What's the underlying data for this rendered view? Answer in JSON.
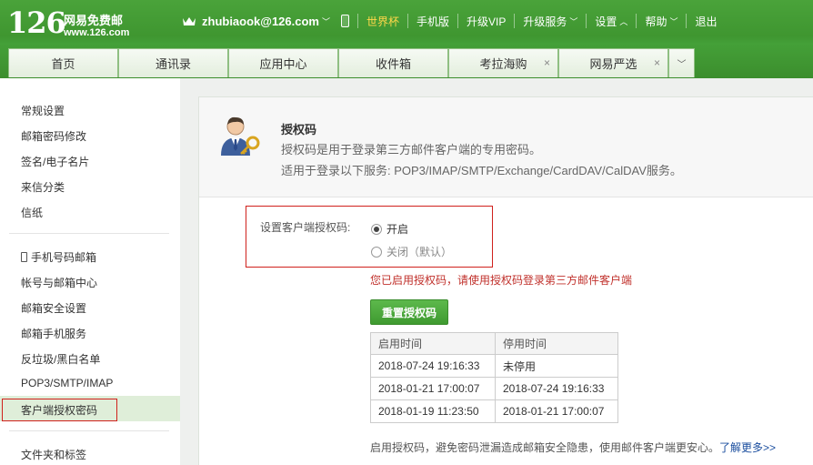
{
  "logo": {
    "number": "126",
    "name": "网易免费邮",
    "url": "www.126.com"
  },
  "topnav": {
    "user": "zhubiaook@126.com",
    "items": [
      "世界杯",
      "手机版",
      "升级VIP",
      "升级服务",
      "设置",
      "帮助",
      "退出"
    ]
  },
  "tabs": [
    "首页",
    "通讯录",
    "应用中心",
    "收件箱",
    "考拉海购",
    "网易严选"
  ],
  "tab_close": "×",
  "sidebar": {
    "group1": [
      "常规设置",
      "邮箱密码修改",
      "签名/电子名片",
      "来信分类",
      "信纸"
    ],
    "group2": [
      "手机号码邮箱",
      "帐号与邮箱中心",
      "邮箱安全设置",
      "邮箱手机服务",
      "反垃圾/黑白名单",
      "POP3/SMTP/IMAP",
      "客户端授权密码"
    ],
    "group3": [
      "文件夹和标签"
    ]
  },
  "main": {
    "title": "授权码",
    "desc1": "授权码是用于登录第三方邮件客户端的专用密码。",
    "desc2": "适用于登录以下服务: POP3/IMAP/SMTP/Exchange/CardDAV/CalDAV服务。",
    "setting_label": "设置客户端授权码:",
    "option_on": "开启",
    "option_off": "关闭（默认）",
    "notice": "您已启用授权码，请使用授权码登录第三方邮件客户端",
    "reset_button": "重置授权码",
    "table": {
      "headers": [
        "启用时间",
        "停用时间"
      ],
      "rows": [
        [
          "2018-07-24 19:16:33",
          "未停用"
        ],
        [
          "2018-01-21 17:00:07",
          "2018-07-24 19:16:33"
        ],
        [
          "2018-01-19 11:23:50",
          "2018-01-21 17:00:07"
        ]
      ]
    },
    "footer_text": "启用授权码，避免密码泄漏造成邮箱安全隐患，使用邮件客户端更安心。",
    "footer_link": "了解更多>>"
  },
  "colors": {
    "brand_green": "#3f9630",
    "alert_red": "#d0211c",
    "link_blue": "#1a4d9e"
  }
}
